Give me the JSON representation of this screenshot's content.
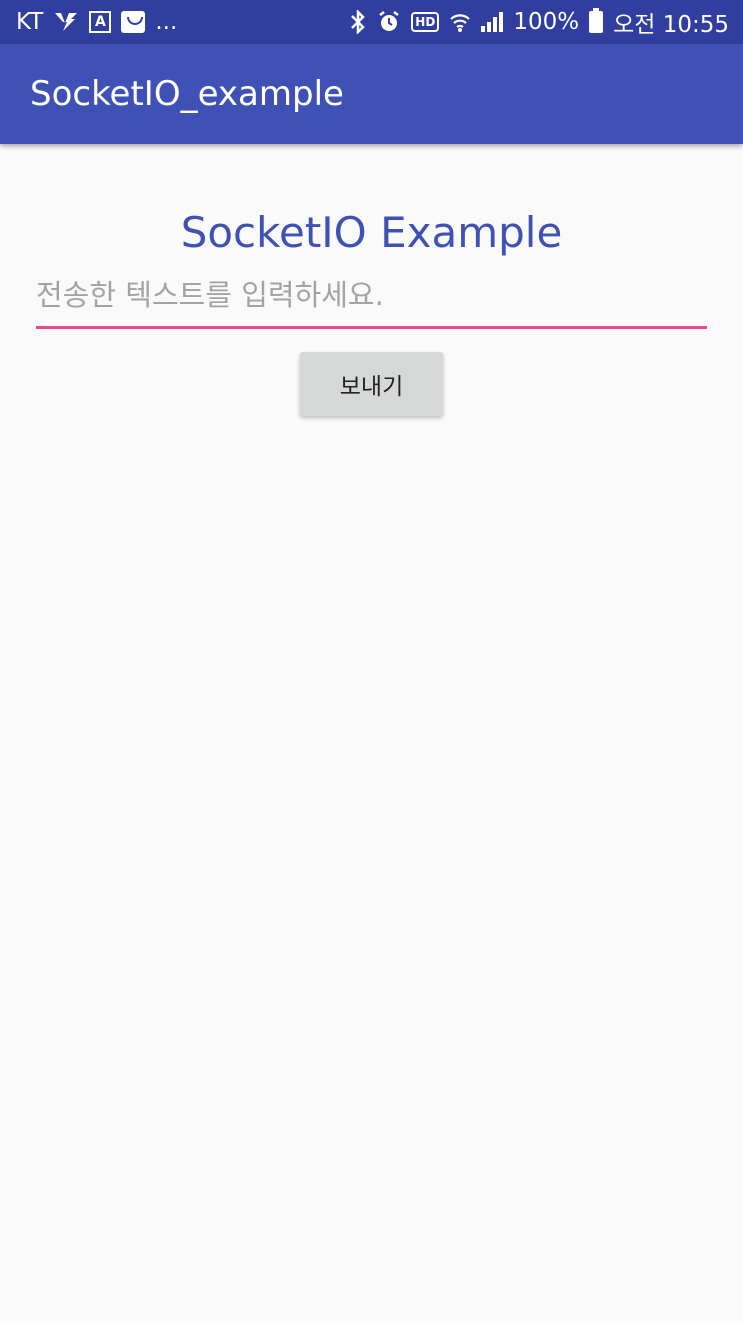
{
  "status_bar": {
    "carrier": "KT",
    "more": "...",
    "hd": "HD",
    "battery": "100%",
    "time": "오전 10:55",
    "notification_a": "A"
  },
  "app_bar": {
    "title": "SocketIO_example"
  },
  "main": {
    "heading": "SocketIO Example",
    "input_placeholder": "전송한 텍스트를 입력하세요.",
    "input_value": "",
    "send_button": "보내기"
  },
  "colors": {
    "status_bar": "#303f9f",
    "app_bar": "#3f51b5",
    "accent": "#e84a8a",
    "background": "#fafafa"
  }
}
